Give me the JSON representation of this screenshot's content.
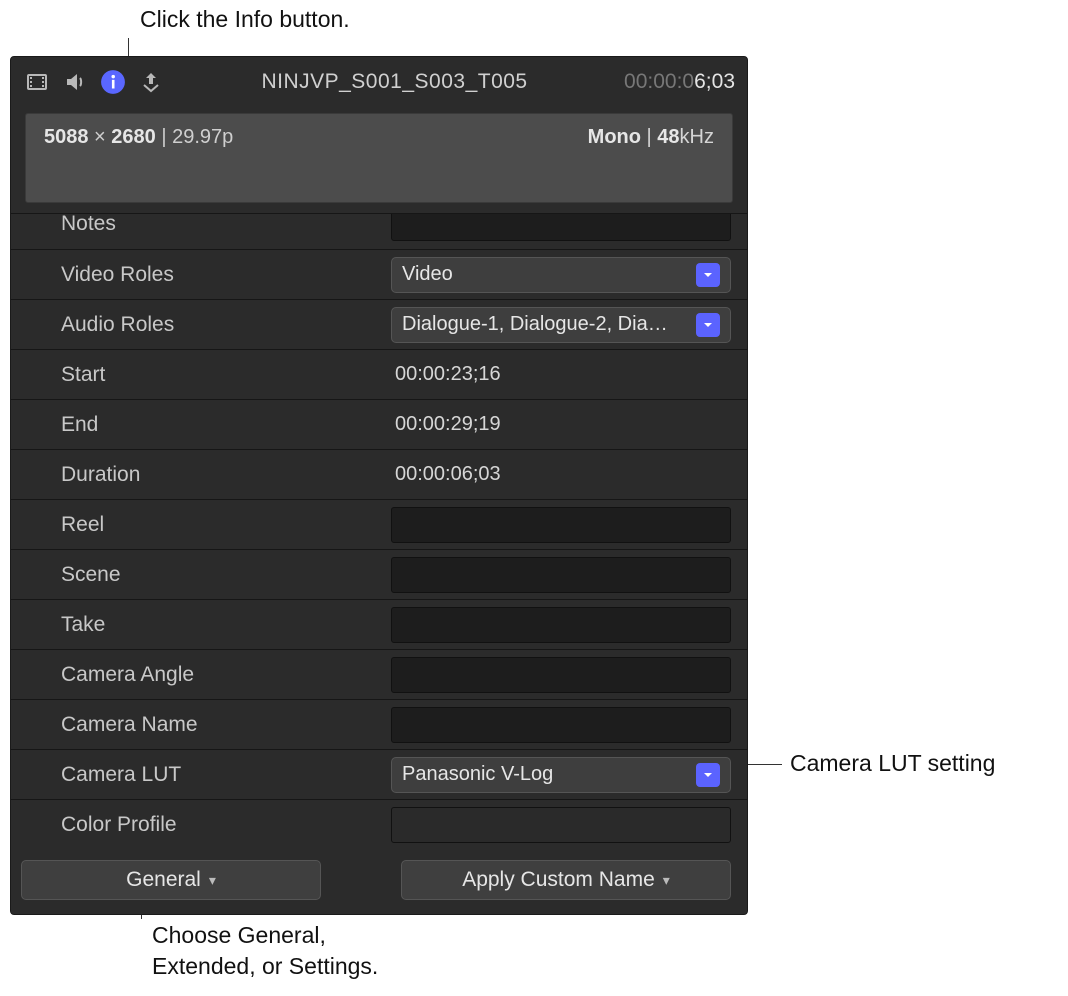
{
  "callouts": {
    "top": "Click the Info button.",
    "right": "Camera LUT setting",
    "bottom_line1": "Choose General,",
    "bottom_line2": "Extended, or Settings."
  },
  "header": {
    "clip_name": "NINJVP_S001_S003_T005",
    "timecode_dim": "00:00:0",
    "timecode_bright": "6;03"
  },
  "format": {
    "res_w": "5088",
    "res_h": "2680",
    "fps": "29.97p",
    "audio_channels": "Mono",
    "sample_rate": "48",
    "khz_label": "kHz"
  },
  "rows": {
    "notes": {
      "label": "Notes",
      "value": ""
    },
    "video_roles": {
      "label": "Video Roles",
      "value": "Video"
    },
    "audio_roles": {
      "label": "Audio Roles",
      "value": "Dialogue-1, Dialogue-2, Dia…"
    },
    "start": {
      "label": "Start",
      "value": "00:00:23;16"
    },
    "end": {
      "label": "End",
      "value": "00:00:29;19"
    },
    "duration": {
      "label": "Duration",
      "value": "00:00:06;03"
    },
    "reel": {
      "label": "Reel",
      "value": ""
    },
    "scene": {
      "label": "Scene",
      "value": ""
    },
    "take": {
      "label": "Take",
      "value": ""
    },
    "camera_angle": {
      "label": "Camera Angle",
      "value": ""
    },
    "camera_name": {
      "label": "Camera Name",
      "value": ""
    },
    "camera_lut": {
      "label": "Camera LUT",
      "value": "Panasonic V-Log"
    },
    "color_profile": {
      "label": "Color Profile",
      "value": ""
    }
  },
  "footer": {
    "view_menu": "General",
    "custom_name": "Apply Custom Name"
  }
}
